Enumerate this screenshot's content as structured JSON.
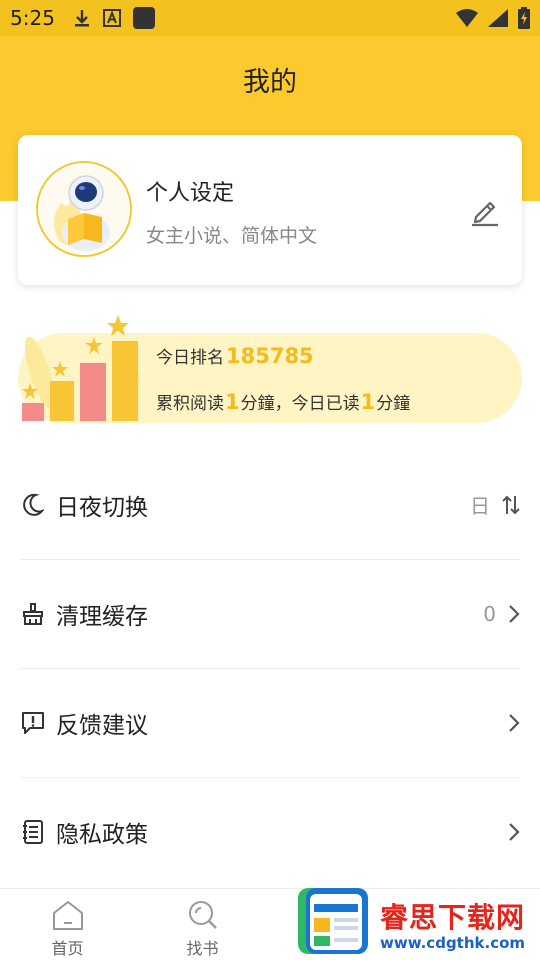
{
  "status_bar": {
    "time": "5:25",
    "left_icons": [
      "download-icon",
      "a-box-icon",
      "app-square-icon"
    ],
    "right_icons": [
      "wifi-icon",
      "signal-icon",
      "battery-charging-icon"
    ]
  },
  "header": {
    "title": "我的",
    "bg_color": "#fcca2e"
  },
  "profile": {
    "name": "个人设定",
    "subtitle": "女主小说、简体中文",
    "avatar_icon": "astronaut-reading-avatar",
    "edit_icon": "edit-pencil-icon"
  },
  "rank": {
    "label": "今日排名",
    "number": "185785",
    "total_prefix": "累积阅读",
    "total_value": "1",
    "unit1": "分鐘，今日已读",
    "today_value": "1",
    "unit2": "分鐘",
    "accent_color": "#f3bc1c"
  },
  "menu": [
    {
      "label": "日夜切换",
      "icon": "moon-icon",
      "value": "日",
      "right_icon": "swap-arrows-icon"
    },
    {
      "label": "清理缓存",
      "icon": "broom-icon",
      "value": "0",
      "right_icon": "chevron-right-icon"
    },
    {
      "label": "反馈建议",
      "icon": "feedback-icon",
      "value": "",
      "right_icon": "chevron-right-icon"
    },
    {
      "label": "隐私政策",
      "icon": "document-list-icon",
      "value": "",
      "right_icon": "chevron-right-icon"
    }
  ],
  "tab_bar": {
    "tabs": [
      {
        "label": "首页",
        "icon": "home-icon"
      },
      {
        "label": "找书",
        "icon": "search-icon"
      }
    ]
  },
  "watermark": {
    "title": "睿思下载网",
    "url": "www.cdgthk.com"
  }
}
